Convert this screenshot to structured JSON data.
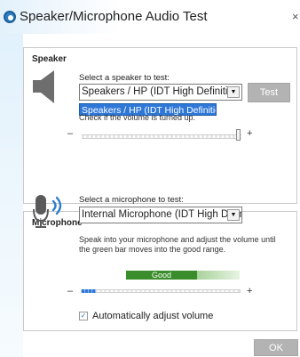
{
  "window": {
    "title": "Speaker/Microphone Audio Test",
    "close_glyph": "×",
    "app_icon": "audio-app-icon"
  },
  "speaker": {
    "heading": "Speaker",
    "select_label": "Select a speaker to test:",
    "selected_value": "Speakers / HP (IDT High Definition Audio CODEC)",
    "dropdown_highlight": "Speakers / HP (IDT High Definition Audio CODEC)",
    "obscured_hint": "Check if the volume is turned up.",
    "test_button": "Test",
    "volume_minus": "–",
    "volume_plus": "+",
    "volume_level": 0.96,
    "icon": "speaker-icon"
  },
  "microphone": {
    "heading": "Microphone",
    "select_label": "Select a microphone to test:",
    "selected_value": "Internal Microphone (IDT High Definition Audio CODEC)",
    "instructions_line1": "Speak into your microphone and adjust the volume until",
    "instructions_line2": "the green bar moves into the good range.",
    "good_label": "Good",
    "level_minus": "–",
    "level_plus": "+",
    "input_level": 0.1,
    "auto_adjust_label": "Automatically adjust volume",
    "auto_adjust_checked": "✓",
    "icon": "microphone-icon"
  },
  "footer": {
    "ok_button": "OK"
  },
  "colors": {
    "accent": "#2f78d8",
    "good_green": "#3a8d2a",
    "button_gray": "#b3b3b3"
  }
}
